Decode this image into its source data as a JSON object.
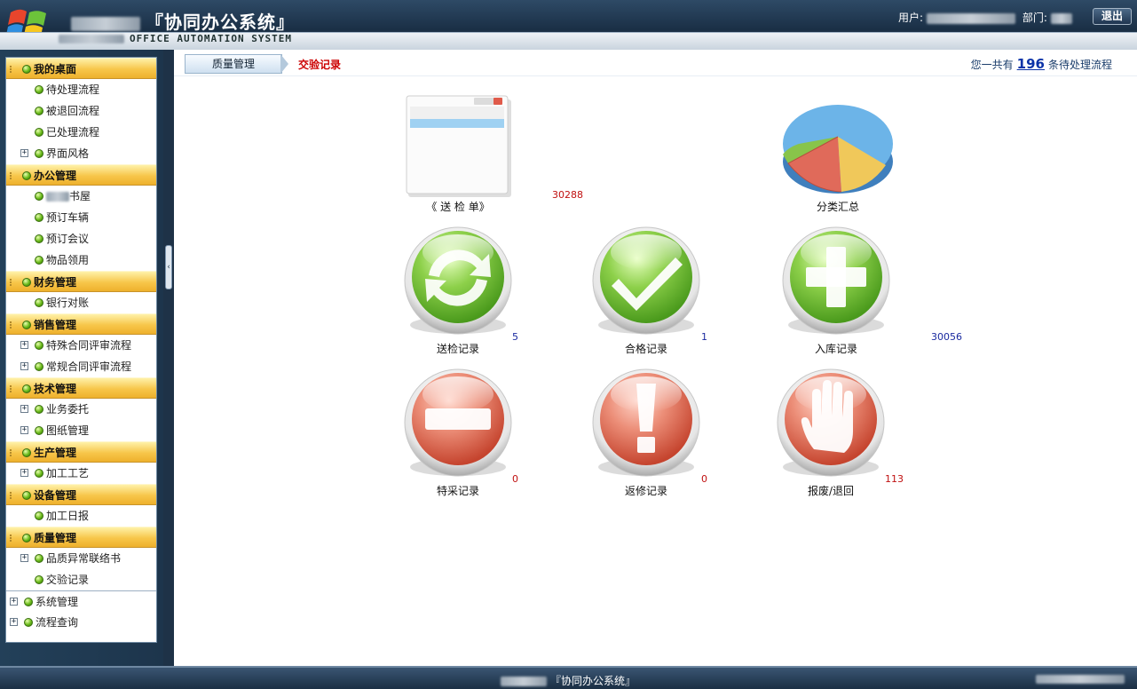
{
  "header": {
    "title": "『协同办公系统』",
    "subtitle": "OFFICE AUTOMATION SYSTEM",
    "user_label": "用户:",
    "dept_label": "部门:",
    "logout_label": "退出"
  },
  "sidebar": {
    "groups": [
      {
        "title": "我的桌面",
        "items": [
          {
            "label": "待处理流程",
            "expandable": false
          },
          {
            "label": "被退回流程",
            "expandable": false
          },
          {
            "label": "已处理流程",
            "expandable": false
          },
          {
            "label": "界面风格",
            "expandable": true
          }
        ]
      },
      {
        "title": "办公管理",
        "items": [
          {
            "label": "书屋",
            "expandable": false
          },
          {
            "label": "预订车辆",
            "expandable": false
          },
          {
            "label": "预订会议",
            "expandable": false
          },
          {
            "label": "物品领用",
            "expandable": false
          }
        ]
      },
      {
        "title": "财务管理",
        "items": [
          {
            "label": "银行对账",
            "expandable": false
          }
        ]
      },
      {
        "title": "销售管理",
        "items": [
          {
            "label": "特殊合同评审流程",
            "expandable": true
          },
          {
            "label": "常规合同评审流程",
            "expandable": true
          }
        ]
      },
      {
        "title": "技术管理",
        "items": [
          {
            "label": "业务委托",
            "expandable": true
          },
          {
            "label": "图纸管理",
            "expandable": true
          }
        ]
      },
      {
        "title": "生产管理",
        "items": [
          {
            "label": "加工工艺",
            "expandable": true
          }
        ]
      },
      {
        "title": "设备管理",
        "items": [
          {
            "label": "加工日报",
            "expandable": false
          }
        ]
      },
      {
        "title": "质量管理",
        "items": [
          {
            "label": "品质异常联络书",
            "expandable": true
          },
          {
            "label": "交验记录",
            "expandable": false
          }
        ]
      }
    ],
    "root_items": [
      {
        "label": "系统管理"
      },
      {
        "label": "流程查询"
      }
    ]
  },
  "breadcrumb": {
    "parent": "质量管理",
    "current": "交验记录"
  },
  "pending": {
    "prefix": "您一共有",
    "count": "196",
    "suffix": "条待处理流程"
  },
  "tiles": [
    {
      "id": "songjiandan",
      "label": "《 送 检 单》",
      "count": "30288",
      "count_color": "red",
      "icon": "form-window-icon"
    },
    {
      "id": "fenlei",
      "label": "分类汇总",
      "count": "",
      "count_color": "red",
      "icon": "pie-chart-icon"
    },
    {
      "id": "songjian",
      "label": "送检记录",
      "count": "5",
      "count_color": "blue",
      "icon": "refresh-icon"
    },
    {
      "id": "hege",
      "label": "合格记录",
      "count": "1",
      "count_color": "blue",
      "icon": "checkmark-icon"
    },
    {
      "id": "ruku",
      "label": "入库记录",
      "count": "30056",
      "count_color": "blue",
      "icon": "plus-icon"
    },
    {
      "id": "tecai",
      "label": "特采记录",
      "count": "0",
      "count_color": "red",
      "icon": "minus-icon"
    },
    {
      "id": "fanxiu",
      "label": "返修记录",
      "count": "0",
      "count_color": "red",
      "icon": "exclamation-icon"
    },
    {
      "id": "baofei",
      "label": "报废/退回",
      "count": "113",
      "count_color": "red",
      "icon": "stop-hand-icon"
    }
  ],
  "footer": {
    "text": "『协同办公系统』"
  },
  "colors": {
    "accent_gold": "#f7c64a",
    "header_navy": "#1a2f45",
    "count_red": "#c01010",
    "count_blue": "#1a2aa0",
    "green_button": "#7cc23a",
    "red_button": "#e0604a"
  }
}
